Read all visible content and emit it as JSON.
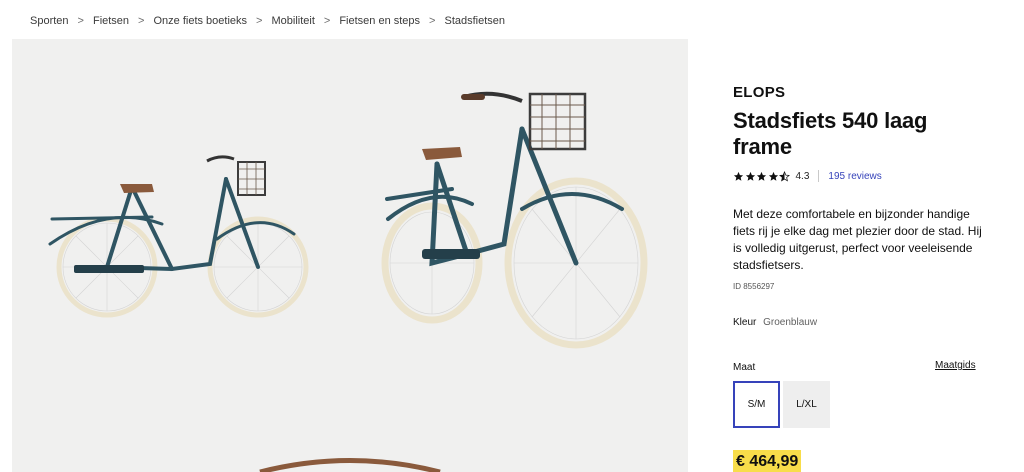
{
  "breadcrumb": {
    "items": [
      "Sporten",
      "Fietsen",
      "Onze fiets boetieks",
      "Mobiliteit",
      "Fietsen en steps",
      "Stadsfietsen"
    ],
    "separator": ">"
  },
  "gallery": {
    "images": [
      {
        "label": "bike-side-view"
      },
      {
        "label": "bike-angled-view"
      }
    ]
  },
  "product": {
    "brand": "ELOPS",
    "title": "Stadsfiets 540 laag frame",
    "rating": {
      "stars": 4.5,
      "value": "4.3",
      "reviews_label": "195 reviews"
    },
    "description": "Met deze comfortabele en bijzonder handige fiets rij je elke dag met plezier door de stad. Hij is volledig uitgerust, perfect voor veeleisende stadsfietsers.",
    "id_label": "ID 8556297",
    "color": {
      "label": "Kleur",
      "value": "Groenblauw"
    },
    "size": {
      "label": "Maat",
      "guide_label": "Maatgids",
      "options": [
        {
          "label": "S/M",
          "selected": true
        },
        {
          "label": "L/XL",
          "selected": false
        }
      ]
    },
    "price": "€ 464,99"
  },
  "colors": {
    "accent": "#3643ba",
    "price_bg": "#f8dd4a",
    "frame": "#2f5563",
    "tire": "#ebe3cc",
    "saddle": "#8a5a3c"
  }
}
